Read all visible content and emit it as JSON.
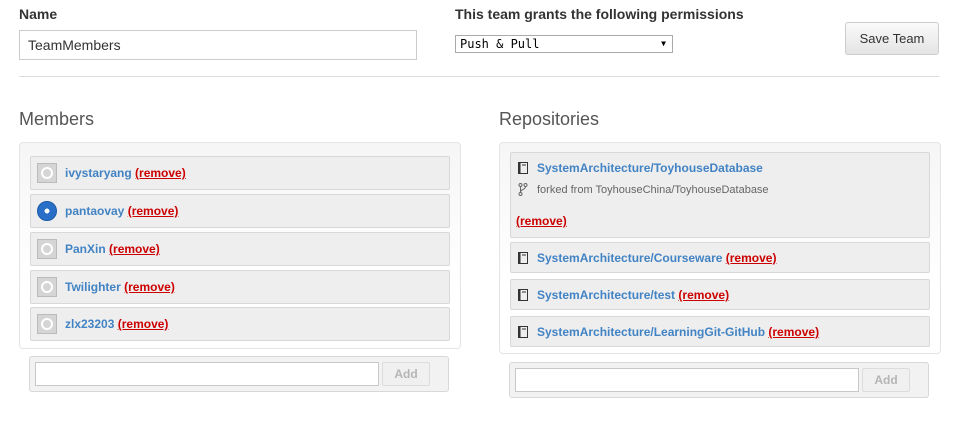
{
  "form": {
    "name_label": "Name",
    "name_value": "TeamMembers",
    "permissions_label": "This team grants the following permissions",
    "permissions_value": "Push & Pull",
    "save_label": "Save Team"
  },
  "members": {
    "title": "Members",
    "items": [
      {
        "username": "ivystaryang",
        "remove": "(remove)",
        "avatar": "github-default-avatar"
      },
      {
        "username": "pantaovay",
        "remove": "(remove)",
        "avatar": "custom-avatar"
      },
      {
        "username": "PanXin",
        "remove": "(remove)",
        "avatar": "github-default-avatar"
      },
      {
        "username": "Twilighter",
        "remove": "(remove)",
        "avatar": "github-default-avatar"
      },
      {
        "username": "zlx23203",
        "remove": "(remove)",
        "avatar": "github-default-avatar"
      }
    ],
    "add_label": "Add"
  },
  "repositories": {
    "title": "Repositories",
    "items": [
      {
        "name": "SystemArchitecture/ToyhouseDatabase",
        "forked_from": "forked from ToyhouseChina/ToyhouseDatabase",
        "remove": "(remove)",
        "icon": "repo-book-icon"
      },
      {
        "name": "SystemArchitecture/Courseware",
        "remove": "(remove)",
        "icon": "repo-book-icon"
      },
      {
        "name": "SystemArchitecture/test",
        "remove": "(remove)",
        "icon": "repo-book-icon"
      },
      {
        "name": "SystemArchitecture/LearningGit-GitHub",
        "remove": "(remove)",
        "icon": "repo-book-icon"
      }
    ],
    "add_label": "Add"
  },
  "colors": {
    "link": "#4183c4",
    "remove": "#cc0000"
  }
}
